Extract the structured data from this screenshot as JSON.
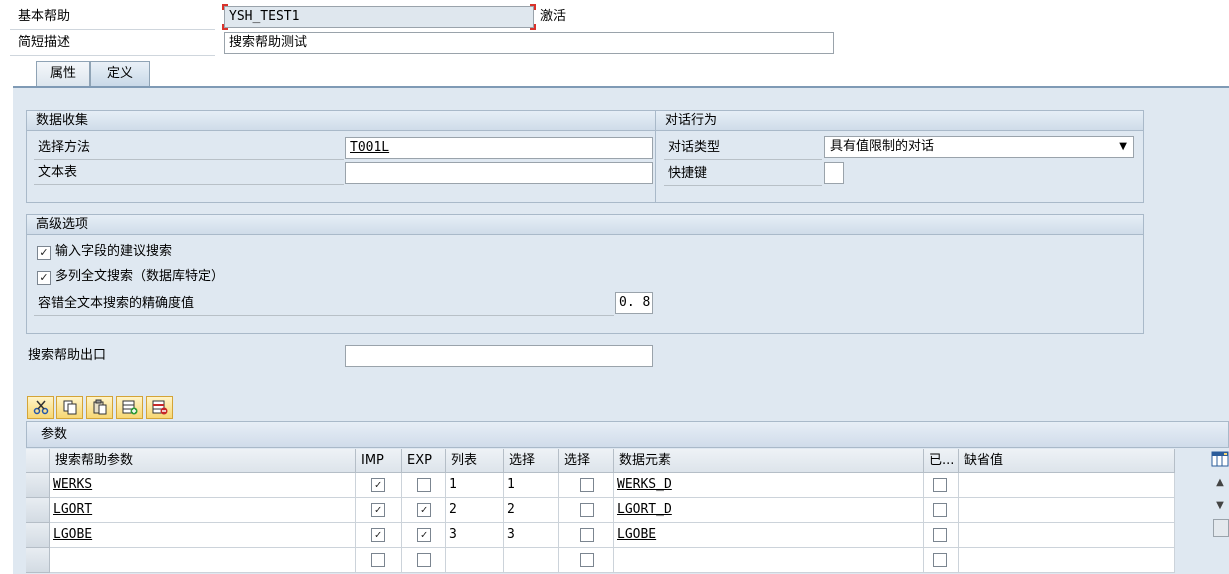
{
  "header": {
    "basic_help_label": "基本帮助",
    "basic_help_value": "YSH_TEST1",
    "status": "激活",
    "short_desc_label": "简短描述",
    "short_desc_value": "搜索帮助测试"
  },
  "tabs": [
    {
      "label": "属性",
      "active": false
    },
    {
      "label": "定义",
      "active": true
    }
  ],
  "data_collection": {
    "title": "数据收集",
    "selection_method_label": "选择方法",
    "selection_method_value": "T001L",
    "text_table_label": "文本表",
    "text_table_value": ""
  },
  "dialog_behavior": {
    "title": "对话行为",
    "dialog_type_label": "对话类型",
    "dialog_type_value": "具有值限制的对话",
    "hotkey_label": "快捷键",
    "hotkey_value": ""
  },
  "advanced": {
    "title": "高级选项",
    "proposal_search_label": "输入字段的建议搜索",
    "proposal_search_checked": true,
    "fulltext_label": "多列全文搜索（数据库特定）",
    "fulltext_checked": true,
    "accuracy_label": "容错全文本搜索的精确度值",
    "accuracy_value": "0. 8"
  },
  "exit": {
    "label": "搜索帮助出口",
    "value": ""
  },
  "toolbar": {
    "icons": [
      "cut-icon",
      "copy-icon",
      "paste-icon",
      "insert-row-icon",
      "delete-row-icon"
    ]
  },
  "params": {
    "title": "参数",
    "columns": [
      "搜索帮助参数",
      "IMP",
      "EXP",
      "列表",
      "选择",
      "选择",
      "数据元素",
      "已...",
      "缺省值"
    ],
    "rows": [
      {
        "param": "WERKS",
        "imp": true,
        "exp": false,
        "lpos": "1",
        "spos": "1",
        "sdis": false,
        "element": "WERKS_D",
        "mod": false,
        "default": ""
      },
      {
        "param": "LGORT",
        "imp": true,
        "exp": true,
        "lpos": "2",
        "spos": "2",
        "sdis": false,
        "element": "LGORT_D",
        "mod": false,
        "default": ""
      },
      {
        "param": "LGOBE",
        "imp": true,
        "exp": true,
        "lpos": "3",
        "spos": "3",
        "sdis": false,
        "element": "LGOBE",
        "mod": false,
        "default": ""
      },
      {
        "param": "",
        "imp": false,
        "exp": false,
        "lpos": "",
        "spos": "",
        "sdis": false,
        "element": "",
        "mod": false,
        "default": ""
      }
    ]
  },
  "colors": {
    "panel_bg": "#dfe8f1",
    "group_border": "#a9b9c9",
    "tool_button": "#f7d774",
    "required_marker": "#d9322b"
  }
}
